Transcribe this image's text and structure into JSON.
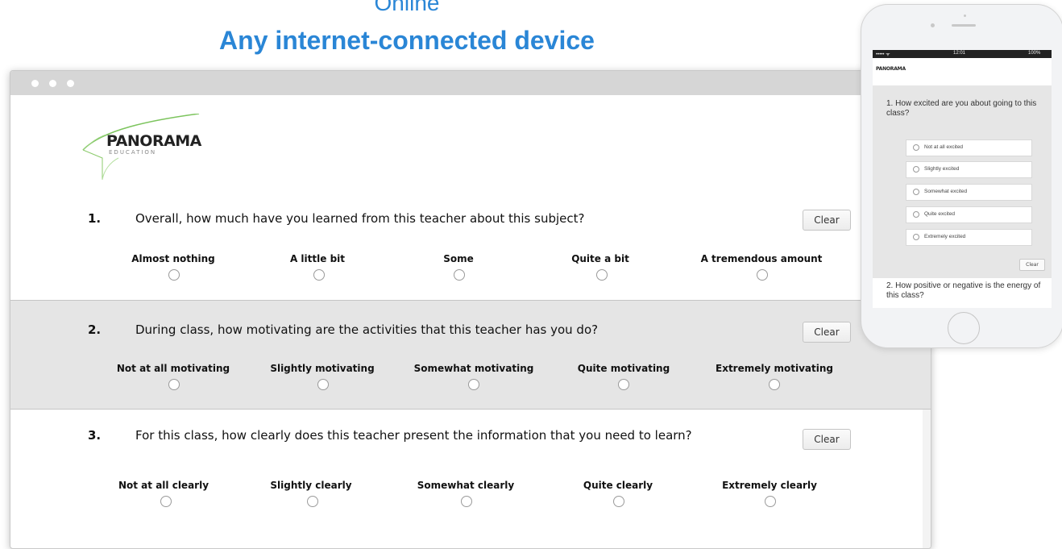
{
  "headline": {
    "top": "Online",
    "main": "Any internet-connected device"
  },
  "logo": {
    "name": "PANORAMA",
    "sub": "EDUCATION"
  },
  "questions": [
    {
      "number": "1.",
      "text": "Overall, how much have you learned from this teacher about this subject?",
      "clear": "Clear",
      "options": [
        "Almost nothing",
        "A little bit",
        "Some",
        "Quite a bit",
        "A tremendous amount"
      ]
    },
    {
      "number": "2.",
      "text": "During class, how motivating are the activities that this teacher has you do?",
      "clear": "Clear",
      "options": [
        "Not at all motivating",
        "Slightly motivating",
        "Somewhat motivating",
        "Quite motivating",
        "Extremely motivating"
      ]
    },
    {
      "number": "3.",
      "text": "For this class, how clearly does this teacher present the information that you need to learn?",
      "clear": "Clear",
      "options": [
        "Not at all clearly",
        "Slightly clearly",
        "Somewhat clearly",
        "Quite clearly",
        "Extremely clearly"
      ]
    }
  ],
  "phone": {
    "status": {
      "signal": "••••• ᯤ",
      "time": "12:01",
      "battery": "100%"
    },
    "logo": "PANORAMA",
    "q1": "1. How excited are you about going to this class?",
    "options": [
      "Not at all excited",
      "Slightly excited",
      "Somewhat excited",
      "Quite excited",
      "Extremely excited"
    ],
    "clear": "Clear",
    "q2": "2. How positive or negative is the energy of this class?"
  }
}
